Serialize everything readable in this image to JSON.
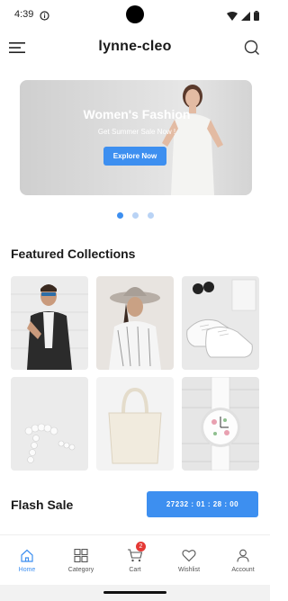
{
  "status_bar": {
    "time": "4:39"
  },
  "app_bar": {
    "title": "lynne-cleo"
  },
  "banner": {
    "title": "Women's Fashion",
    "subtitle": "Get Summer Sale Now !",
    "button_label": "Explore Now",
    "slides_total": 3,
    "active_slide": 1
  },
  "featured": {
    "title": "Featured Collections",
    "items": [
      {
        "icon": "man-in-blazer-photo"
      },
      {
        "icon": "woman-in-hat-photo"
      },
      {
        "icon": "white-sneakers-photo"
      },
      {
        "icon": "pearl-jewelry-photo"
      },
      {
        "icon": "canvas-tote-bag-photo"
      },
      {
        "icon": "floral-watch-photo"
      }
    ]
  },
  "flash_sale": {
    "title": "Flash Sale",
    "countdown": "27232 : 01 : 28 : 00"
  },
  "bottom_nav": {
    "items": [
      {
        "label": "Home",
        "icon": "home-icon",
        "active": true
      },
      {
        "label": "Category",
        "icon": "grid-icon",
        "active": false
      },
      {
        "label": "Cart",
        "icon": "cart-icon",
        "active": false
      },
      {
        "label": "Wishlist",
        "icon": "heart-icon",
        "active": false
      },
      {
        "label": "Account",
        "icon": "user-icon",
        "active": false
      }
    ],
    "cart_count": "2"
  },
  "colors": {
    "accent": "#3d8ff0",
    "badge": "#e53935"
  }
}
